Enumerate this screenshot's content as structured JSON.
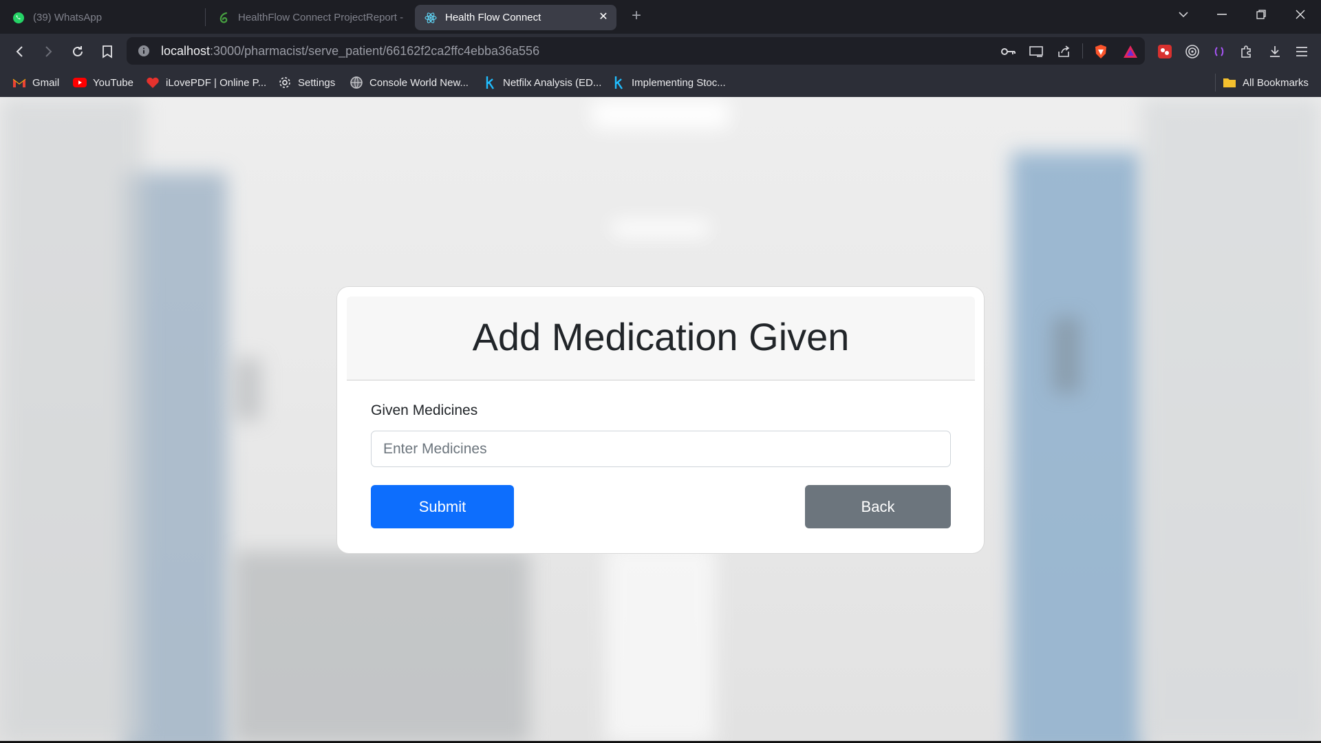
{
  "tabs": [
    {
      "title": "(39) WhatsApp",
      "icon": "whatsapp-icon"
    },
    {
      "title": "HealthFlow Connect ProjectReport -",
      "icon": "overleaf-icon"
    },
    {
      "title": "Health Flow Connect",
      "icon": "react-icon",
      "active": true
    }
  ],
  "toolbar": {
    "url_host": "localhost",
    "url_path": ":3000/pharmacist/serve_patient/66162f2ca2ffc4ebba36a556"
  },
  "bookmarks": [
    {
      "label": "Gmail",
      "icon": "gmail-icon"
    },
    {
      "label": "YouTube",
      "icon": "youtube-icon"
    },
    {
      "label": "iLovePDF | Online P...",
      "icon": "ilovepdf-icon"
    },
    {
      "label": "Settings",
      "icon": "gear-icon"
    },
    {
      "label": "Console World New...",
      "icon": "globe-icon"
    },
    {
      "label": "Netfilx Analysis (ED...",
      "icon": "kaggle-icon"
    },
    {
      "label": "Implementing Stoc...",
      "icon": "kaggle-icon"
    }
  ],
  "all_bookmarks": "All Bookmarks",
  "form": {
    "title": "Add Medication Given",
    "label": "Given Medicines",
    "placeholder": "Enter Medicines",
    "value": "",
    "submit_label": "Submit",
    "back_label": "Back"
  },
  "colors": {
    "primary": "#0d6efd",
    "secondary": "#6c757d",
    "text": "#212529"
  }
}
